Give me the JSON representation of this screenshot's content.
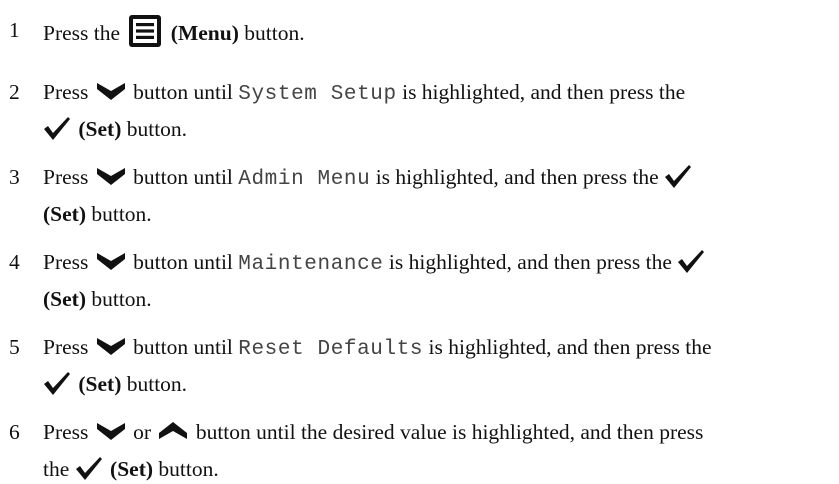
{
  "steps": [
    {
      "num": "1",
      "pre": "Press the",
      "icon_label": "(Menu)",
      "post": "button."
    },
    {
      "num": "2",
      "press": "Press",
      "until": "button until",
      "item": "System Setup",
      "highlighted": "is highlighted, and then press the",
      "set_label": "(Set)",
      "end": "button."
    },
    {
      "num": "3",
      "press": "Press",
      "until": "button until",
      "item": "Admin Menu",
      "highlighted": "is highlighted, and then press the",
      "set_label": "(Set)",
      "end": "button."
    },
    {
      "num": "4",
      "press": "Press",
      "until": "button until",
      "item": "Maintenance",
      "highlighted": "is highlighted, and then press the",
      "set_label": "(Set)",
      "end": "button."
    },
    {
      "num": "5",
      "press": "Press",
      "until": "button until",
      "item": "Reset Defaults",
      "highlighted": "is highlighted, and then press the",
      "set_label": "(Set)",
      "end": "button."
    },
    {
      "num": "6",
      "press": "Press",
      "or": "or",
      "until": "button until the desired value is highlighted, and then press",
      "the": "the",
      "set_label": "(Set)",
      "end": "button."
    }
  ],
  "icons": {
    "menu": "menu-icon",
    "down": "down-arrow-icon",
    "up": "up-arrow-icon",
    "set": "checkmark-icon"
  }
}
